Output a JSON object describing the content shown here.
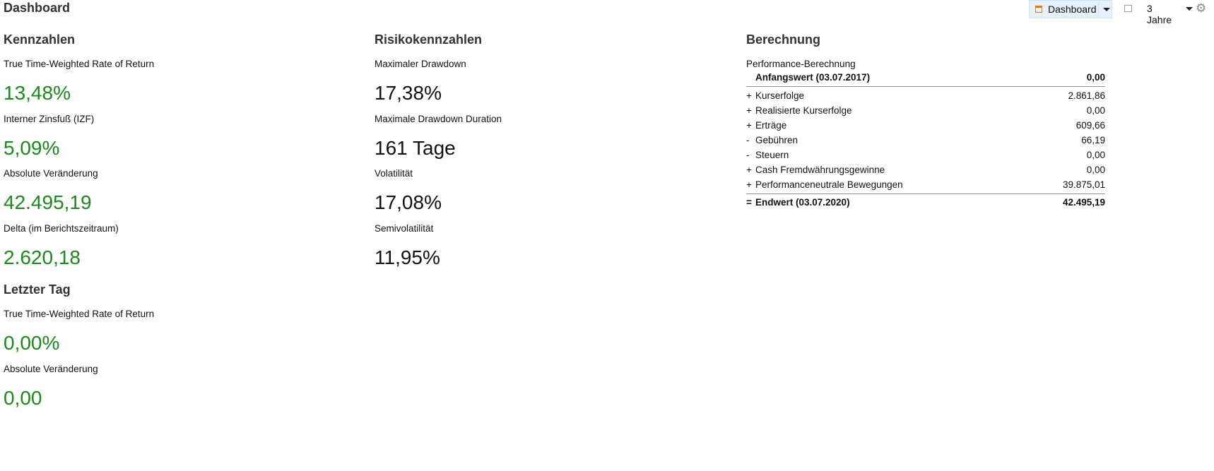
{
  "page": {
    "title": "Dashboard"
  },
  "toolbar": {
    "dashboard_label": "Dashboard",
    "period_label": "3 Jahre",
    "icons": [
      "dashboard-icon",
      "chevron-down-icon",
      "window-icon",
      "chevron-down-icon",
      "gear-icon"
    ]
  },
  "kennzahlen": {
    "heading": "Kennzahlen",
    "metrics": [
      {
        "label": "True Time-Weighted Rate of Return",
        "value": "13,48%"
      },
      {
        "label": "Interner Zinsfuß (IZF)",
        "value": "5,09%"
      },
      {
        "label": "Absolute Veränderung",
        "value": "42.495,19"
      },
      {
        "label": "Delta (im Berichtszeitraum)",
        "value": "2.620,18"
      }
    ]
  },
  "letzter_tag": {
    "heading": "Letzter Tag",
    "metrics": [
      {
        "label": "True Time-Weighted Rate of Return",
        "value": "0,00%"
      },
      {
        "label": "Absolute Veränderung",
        "value": "0,00"
      }
    ]
  },
  "risiko": {
    "heading": "Risikokennzahlen",
    "metrics": [
      {
        "label": "Maximaler Drawdown",
        "value": "17,38%"
      },
      {
        "label": "Maximale Drawdown Duration",
        "value": "161 Tage"
      },
      {
        "label": "Volatilität",
        "value": "17,08%"
      },
      {
        "label": "Semivolatilität",
        "value": "11,95%"
      }
    ]
  },
  "berechnung": {
    "heading": "Berechnung",
    "subtitle": "Performance-Berechnung",
    "start": {
      "op": "",
      "name": "Anfangswert (03.07.2017)",
      "value": "0,00"
    },
    "rows": [
      {
        "op": "+",
        "name": "Kurserfolge",
        "value": "2.861,86"
      },
      {
        "op": "+",
        "name": "Realisierte Kurserfolge",
        "value": "0,00"
      },
      {
        "op": "+",
        "name": "Erträge",
        "value": "609,66"
      },
      {
        "op": "-",
        "name": "Gebühren",
        "value": "66,19"
      },
      {
        "op": "-",
        "name": "Steuern",
        "value": "0,00"
      },
      {
        "op": "+",
        "name": "Cash Fremdwährungsgewinne",
        "value": "0,00"
      },
      {
        "op": "+",
        "name": "Performanceneutrale Bewegungen",
        "value": "39.875,01"
      }
    ],
    "end": {
      "op": "=",
      "name": "Endwert (03.07.2020)",
      "value": "42.495,19"
    }
  }
}
